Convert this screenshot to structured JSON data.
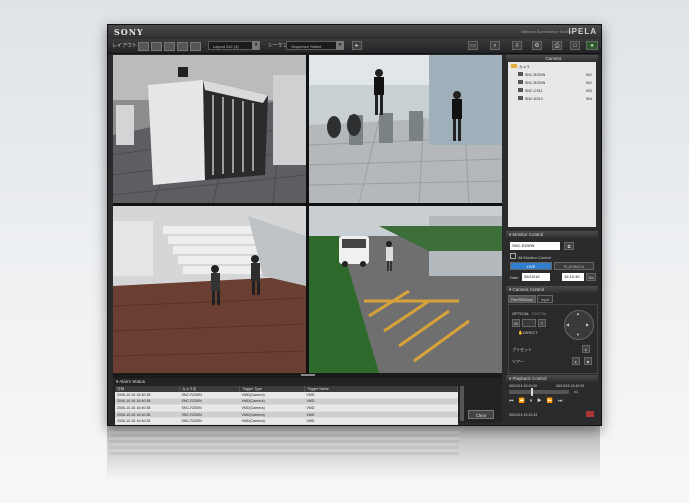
{
  "window": {
    "brand": "SONY",
    "product": "Network Surveillance Monitor",
    "logo": "IPELA"
  },
  "toolbar": {
    "layout_label": "レイアウト",
    "layout_select": "Layout 2x2 (4)",
    "sequence_label": "シーケンス",
    "sequence_select": "Sequence Select",
    "icons": [
      "monitor-icon",
      "search-icon",
      "settings-icon",
      "list-icon",
      "printer-icon",
      "window-icon",
      "camera-icon"
    ]
  },
  "cameras": {
    "title": "Camera",
    "root": "カメラ",
    "items": [
      {
        "name": "SNC-RZ50N",
        "id": "901"
      },
      {
        "name": "SNC-RZ50N",
        "id": "901"
      },
      {
        "name": "SNC-CS11",
        "id": "903"
      },
      {
        "name": "SNC-DS10",
        "id": "904"
      }
    ]
  },
  "monitor_control": {
    "title": "Monitor Control",
    "camera": "SNC-RZ50N",
    "all_monitor": "All Monitor Control",
    "live": "LIVE",
    "playback": "PLAYBACK",
    "date_label": "Date",
    "date": "06/10/16",
    "time": "16:10:30",
    "go": "Go"
  },
  "camera_control": {
    "title": "Camera Control",
    "tab_pt": "Pan/Tilt/Zoom",
    "tab_input": "Input",
    "optical": "OPTICAL",
    "digital": "DIGITAL",
    "direct": "DIRECT",
    "preset": "プリセット",
    "tour": "ツアー"
  },
  "playback_control": {
    "title": "Playback Control",
    "start": "06/10/16 16:10:00",
    "end": "06/10/16 16:40:00",
    "current": "06/10/16 16:22:43",
    "speed": "x1"
  },
  "alarm": {
    "title": "Alarm Status",
    "columns": [
      "日時",
      "カメラ名",
      "Trigger Type",
      "Trigger Name"
    ],
    "rows": [
      [
        "2006-10-16 16:40:38",
        "SNC-RZ50N",
        "VMD(Camera)",
        "VMD"
      ],
      [
        "2006-10-16 16:40:38",
        "SNC-RZ50N",
        "VMD(Camera)",
        "VMD"
      ],
      [
        "2006-10-16 16:40:38",
        "SNC-RZ50N",
        "VMD(Camera)",
        "VMD"
      ],
      [
        "2006-10-16 16:40:38",
        "SNC-RZ50N",
        "VMD(Camera)",
        "VMD"
      ],
      [
        "2006-10-16 16:40:38",
        "SNC-RZ50N",
        "VMD(Camera)",
        "VMD"
      ]
    ],
    "clear": "Clear"
  },
  "colors": {
    "accent": "#2f7fd1",
    "panel": "#2b2b2d",
    "header": "#3b3b3e"
  }
}
